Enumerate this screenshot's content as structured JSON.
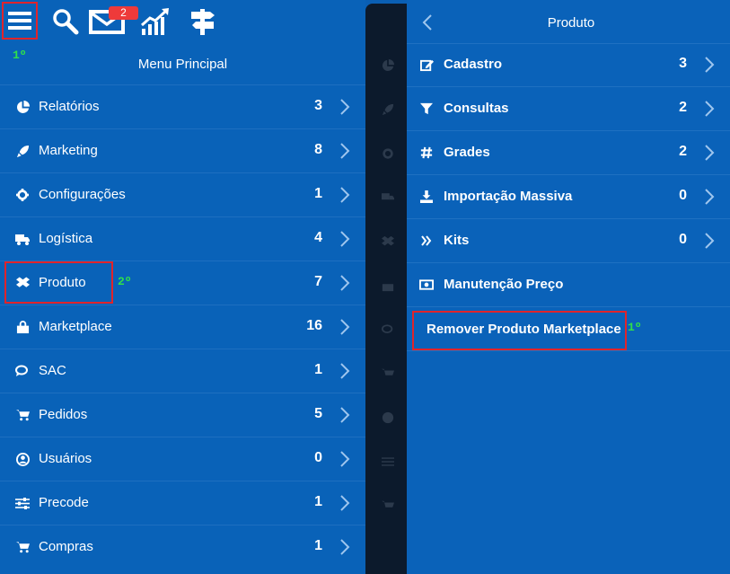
{
  "topbar": {
    "notification_count": "2",
    "icons": [
      "menu-icon",
      "search-icon",
      "mail-icon",
      "chart-icon",
      "signpost-icon"
    ]
  },
  "annotations": {
    "step1_left": "1º",
    "step2": "2º",
    "step1_right": "1º"
  },
  "menu": {
    "title": "Menu Principal",
    "items": [
      {
        "label": "Relatórios",
        "count": "3",
        "icon": "pie-chart-icon"
      },
      {
        "label": "Marketing",
        "count": "8",
        "icon": "rocket-icon"
      },
      {
        "label": "Configurações",
        "count": "1",
        "icon": "gear-icon"
      },
      {
        "label": "Logística",
        "count": "4",
        "icon": "truck-icon"
      },
      {
        "label": "Produto",
        "count": "7",
        "icon": "box-icon"
      },
      {
        "label": "Marketplace",
        "count": "16",
        "icon": "shopping-bag-icon"
      },
      {
        "label": "SAC",
        "count": "1",
        "icon": "chat-icon"
      },
      {
        "label": "Pedidos",
        "count": "5",
        "icon": "cart-icon"
      },
      {
        "label": "Usuários",
        "count": "0",
        "icon": "user-circle-icon"
      },
      {
        "label": "Precode",
        "count": "1",
        "icon": "sliders-icon"
      },
      {
        "label": "Compras",
        "count": "1",
        "icon": "cart-icon"
      }
    ]
  },
  "submenu": {
    "title": "Produto",
    "items": [
      {
        "label": "Cadastro",
        "count": "3",
        "icon": "edit-icon"
      },
      {
        "label": "Consultas",
        "count": "2",
        "icon": "filter-icon"
      },
      {
        "label": "Grades",
        "count": "2",
        "icon": "hashtag-icon"
      },
      {
        "label": "Importação Massiva",
        "count": "0",
        "icon": "download-icon"
      },
      {
        "label": "Kits",
        "count": "0",
        "icon": "double-chevron-icon"
      },
      {
        "label": "Manutenção Preço",
        "count": "",
        "icon": "money-icon"
      }
    ],
    "highlighted_item": "Remover Produto Marketplace"
  },
  "colors": {
    "panel": "#0962b8",
    "strip": "#0c1a2c",
    "highlight": "#e0242b",
    "annotation": "#2fe04a"
  }
}
